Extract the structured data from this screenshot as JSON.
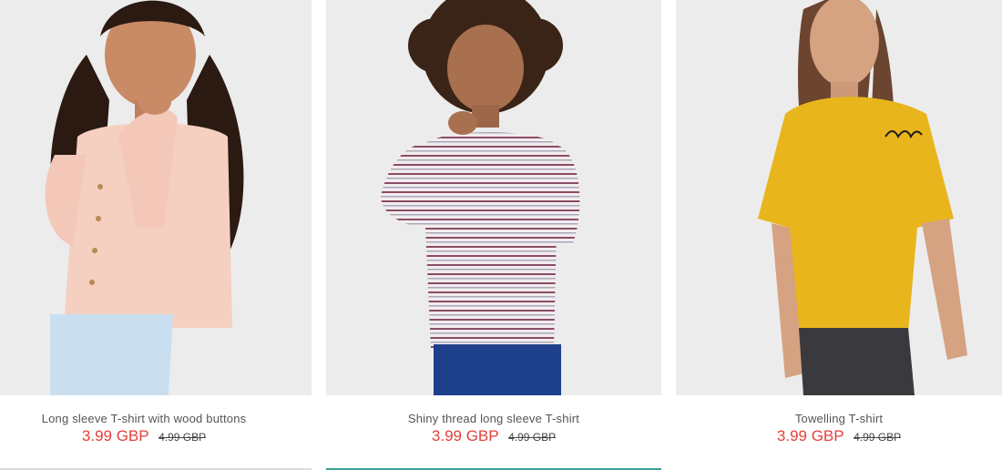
{
  "products": [
    {
      "name": "Long sleeve T-shirt with wood buttons",
      "price": "3.99 GBP",
      "old_price": "4.99 GBP",
      "image_alt": "Girl in pink long sleeve t-shirt"
    },
    {
      "name": "Shiny thread long sleeve T-shirt",
      "price": "3.99 GBP",
      "old_price": "4.99 GBP",
      "image_alt": "Child in striped long sleeve t-shirt"
    },
    {
      "name": "Towelling T-shirt",
      "price": "3.99 GBP",
      "old_price": "4.99 GBP",
      "image_alt": "Girl in yellow towelling t-shirt"
    }
  ],
  "colors": {
    "price_sale": "#e2403a",
    "price_old": "#444444",
    "name_text": "#555555",
    "active_underline": "#3aa394",
    "photo_bg": "#ececec"
  }
}
